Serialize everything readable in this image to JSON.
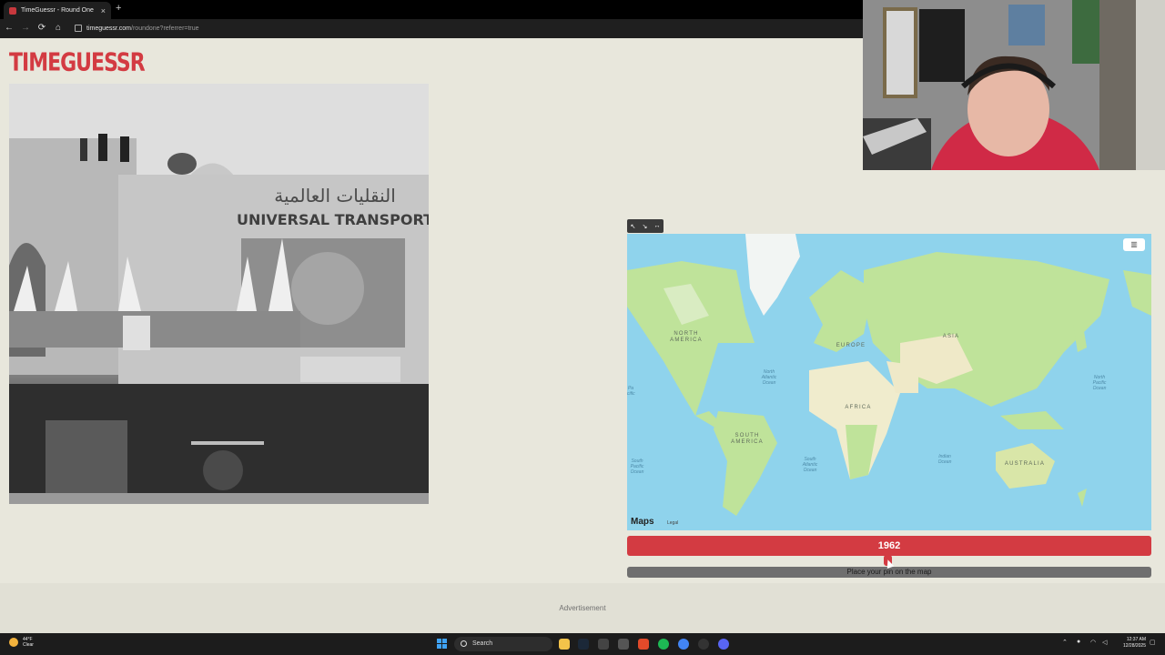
{
  "browser": {
    "tab_title": "TimeGuessr - Round One",
    "tab_close": "×",
    "new_tab": "+",
    "url_host": "timeguessr.com",
    "url_path": "/roundone?referrer=true",
    "nav": {
      "back": "←",
      "forward": "→",
      "reload": "⟳",
      "home": "⌂"
    }
  },
  "page": {
    "logo": "TIMEGUESSR",
    "photo_sign_arabic": "النقليات العالمية",
    "photo_sign_latin": "UNIVERSAL TRANSPORT",
    "advertisement": "Advertisement"
  },
  "map": {
    "controls": [
      "↖",
      "↘",
      "↔"
    ],
    "maptype_icon": "▥",
    "continents": {
      "north_america": "NORTH AMERICA",
      "south_america": "SOUTH AMERICA",
      "europe": "EUROPE",
      "africa": "AFRICA",
      "asia": "ASIA",
      "australia": "AUSTRALIA"
    },
    "oceans": {
      "north_atlantic": "North Atlantic Ocean",
      "north_pacific": "North Pacific Ocean",
      "south_atlantic": "South Atlantic Ocean",
      "south_pacific": "South Pacific Ocean",
      "indian": "Indian Ocean",
      "pacific_left": "Pa cific"
    },
    "attribution": "Maps",
    "legal": "Legal"
  },
  "guess": {
    "year": "1962",
    "year_slider_fraction": 0.498,
    "pin_prompt": "Place your pin on the map"
  },
  "taskbar": {
    "weather_temp": "44°F",
    "weather_desc": "Clear",
    "search": "Search",
    "time": "12:37 AM",
    "date": "12/28/2025"
  },
  "colors": {
    "brand": "#d33b42",
    "ocean": "#8fd3ec",
    "land": "#bfe39a",
    "page_bg": "#e8e7dc"
  }
}
